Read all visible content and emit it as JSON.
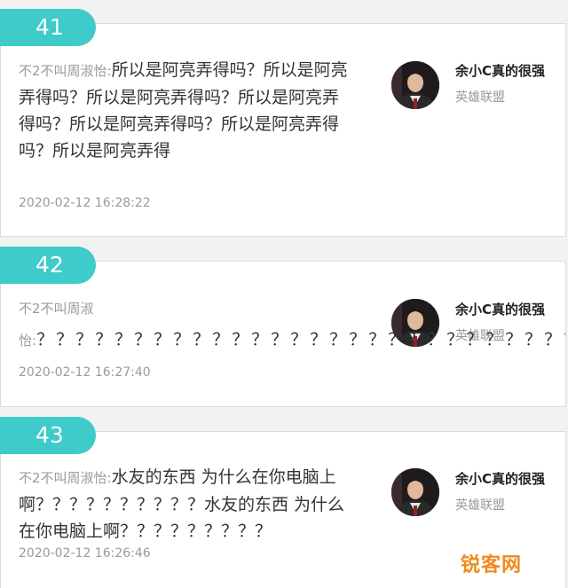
{
  "comments": [
    {
      "number": "41",
      "commenter": "不2不叫周淑怡:",
      "text": "所以是阿亮弄得吗？所以是阿亮弄得吗？所以是阿亮弄得吗？所以是阿亮弄得吗？所以是阿亮弄得吗？所以是阿亮弄得吗？所以是阿亮弄得",
      "time": "2020-02-12 16:28:22",
      "user": {
        "name": "余小C真的很强",
        "group": "英雄联盟"
      }
    },
    {
      "number": "42",
      "commenter_line1": "不2不叫周淑",
      "commenter_line2": "怡:",
      "text": "？？？？？？？？？？？？？？？？？？？？？？？？？？？？？？？",
      "time": "2020-02-12 16:27:40",
      "user": {
        "name": "余小C真的很强",
        "group": "英雄联盟"
      }
    },
    {
      "number": "43",
      "commenter": "不2不叫周淑怡:",
      "text": "水友的东西 为什么在你电脑上啊？？？？？？？？？？水友的东西 为什么在你电脑上啊？？？？？？？？？",
      "time": "2020-02-12 16:26:46",
      "user": {
        "name": "余小C真的很强",
        "group": "英雄联盟"
      }
    }
  ],
  "watermark": "锐客网",
  "colors": {
    "badge": "#3ecbc9",
    "watermark": "#f08a1c"
  },
  "icons": {
    "avatar": "user-avatar-photo"
  }
}
